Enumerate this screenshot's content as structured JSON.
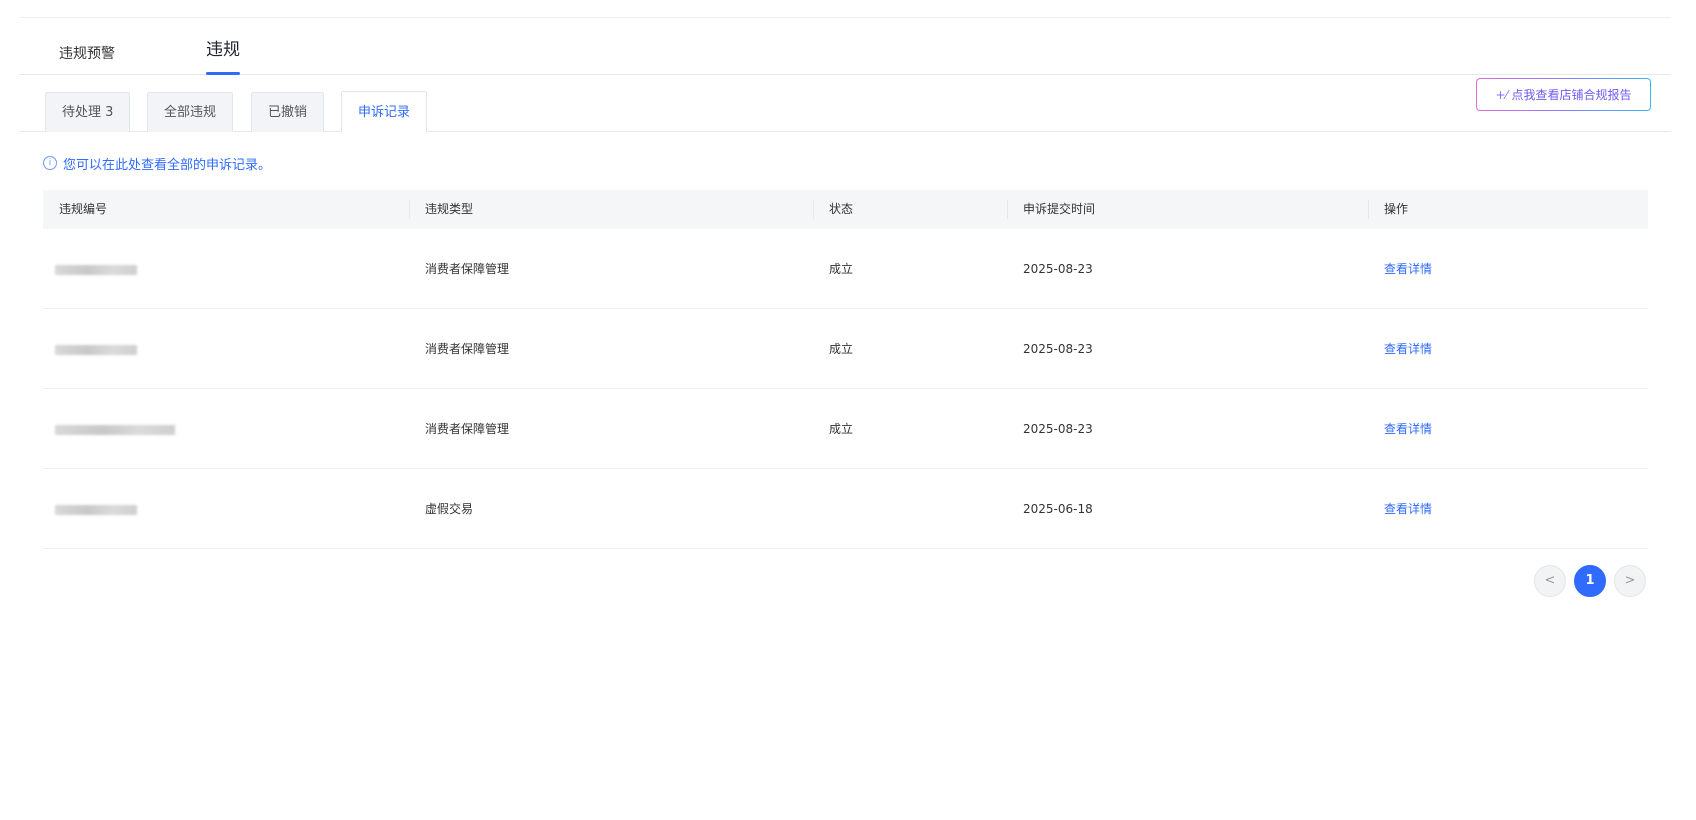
{
  "primary_tabs": [
    {
      "label": "违规预警"
    },
    {
      "label": "违规"
    }
  ],
  "sub_tabs": [
    {
      "label": "待处理 3"
    },
    {
      "label": "全部违规"
    },
    {
      "label": "已撤销"
    },
    {
      "label": "申诉记录"
    }
  ],
  "report_button": {
    "label": "点我查看店铺合规报告",
    "icon": "sparkle-icon"
  },
  "notice": {
    "text": "您可以在此处查看全部的申诉记录。",
    "icon": "info-icon"
  },
  "table": {
    "headers": [
      "违规编号",
      "违规类型",
      "状态",
      "申诉提交时间",
      "操作"
    ],
    "rows": [
      {
        "type": "消费者保障管理",
        "status": "成立",
        "submit_time": "2025-08-23",
        "action": "查看详情"
      },
      {
        "type": "消费者保障管理",
        "status": "成立",
        "submit_time": "2025-08-23",
        "action": "查看详情"
      },
      {
        "type": "消费者保障管理",
        "status": "成立",
        "submit_time": "2025-08-23",
        "action": "查看详情"
      },
      {
        "type": "虚假交易",
        "status": "",
        "submit_time": "2025-06-18",
        "action": "查看详情"
      }
    ]
  },
  "pagination": {
    "prev": "<",
    "current": "1",
    "next": ">"
  },
  "colors": {
    "accent": "#2f6bff",
    "tab_bg": "#f2f4f7",
    "header_bg": "#f5f6f8"
  }
}
